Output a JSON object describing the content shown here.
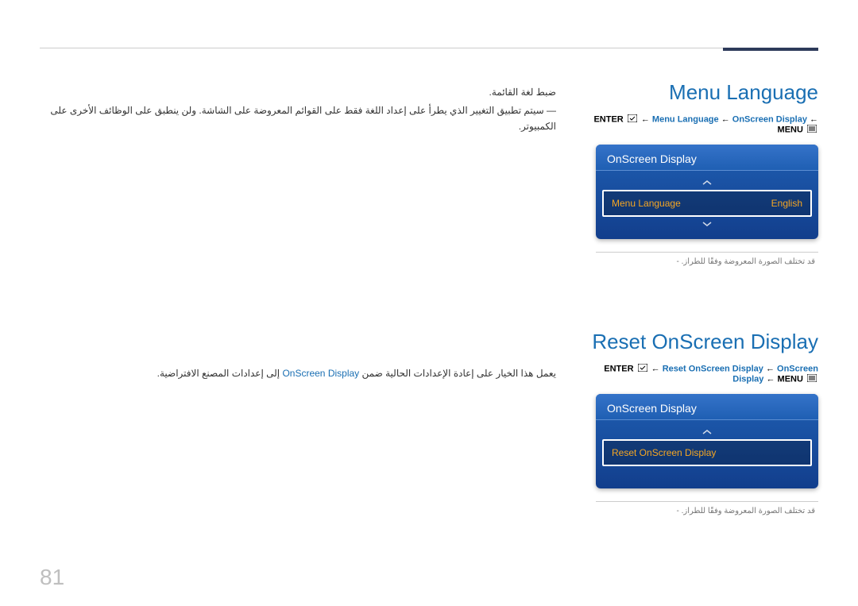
{
  "page_number": "81",
  "menu_language": {
    "title": "Menu Language",
    "breadcrumb": {
      "enter": "ENTER",
      "menu_lang": "Menu Language",
      "onscreen": "OnScreen Display",
      "menu": "MENU",
      "arrow": "←"
    },
    "panel": {
      "header": "OnScreen Display",
      "row_label": "Menu Language",
      "row_value": "English"
    },
    "note": "قد تختلف الصورة المعروضة وفقًا للطراز."
  },
  "reset_osd": {
    "title": "Reset OnScreen Display",
    "breadcrumb": {
      "enter": "ENTER",
      "reset": "Reset OnScreen Display",
      "onscreen": "OnScreen Display",
      "menu": "MENU",
      "arrow": "←"
    },
    "panel": {
      "header": "OnScreen Display",
      "row_label": "Reset OnScreen Display"
    },
    "note": "قد تختلف الصورة المعروضة وفقًا للطراز."
  },
  "left_text": {
    "heading": "ضبط لغة القائمة.",
    "body_prefix": "سيتم تطبيق التغيير الذي يطرأ على إعداد اللغة فقط على القوائم المعروضة على الشاشة. ولن ينطبق على الوظائف الأخرى على الكمبيوتر.",
    "dash": "―",
    "reset_prefix": "يعمل هذا الخيار على إعادة الإعدادات الحالية ضمن ",
    "reset_highlight": "OnScreen Display",
    "reset_suffix": " إلى إعدادات المصنع الافتراضية."
  }
}
